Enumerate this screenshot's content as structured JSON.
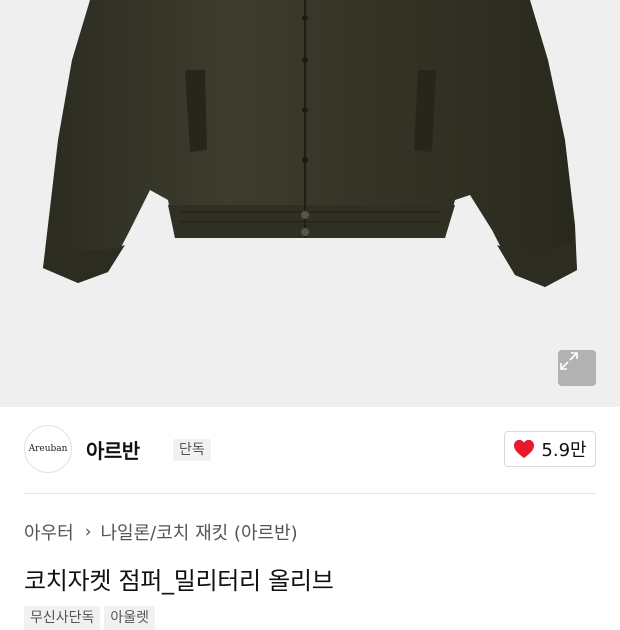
{
  "brand": {
    "logo_text": "Areuban",
    "name": "아르반",
    "badge": "단독"
  },
  "like": {
    "count": "5.9만",
    "icon": "heart-icon",
    "color": "#e8192c"
  },
  "breadcrumb": {
    "category": "아우터",
    "subcategory": "나일론/코치 재킷 (아르반)"
  },
  "product": {
    "title": "코치자켓 점퍼_밀리터리 올리브",
    "tags": [
      "무신사단독",
      "아울렛"
    ]
  },
  "hero": {
    "background": "#efefef",
    "jacket_color": "#3a3a2c",
    "expand_icon": "expand-icon"
  }
}
